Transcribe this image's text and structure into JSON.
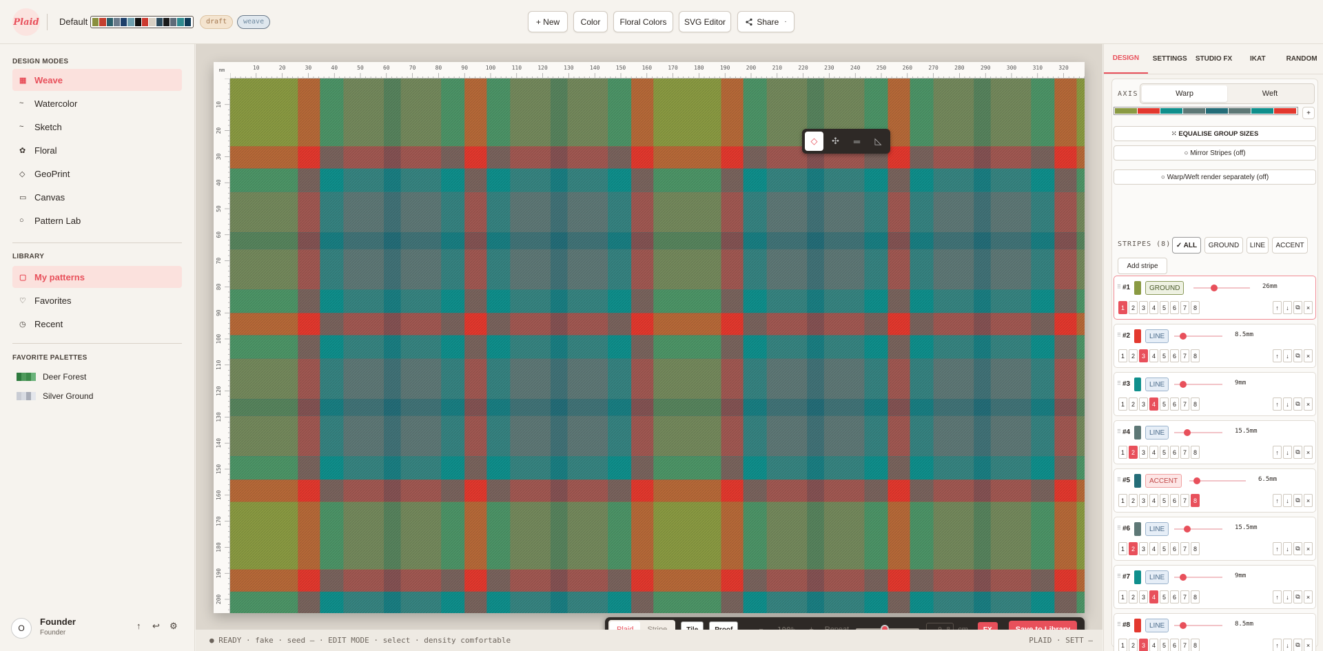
{
  "header": {
    "logo_text": "Plaid",
    "palette_name": "Default",
    "palette_colors": [
      "#8a8f3e",
      "#c4402f",
      "#2b5f6a",
      "#6b7a8a",
      "#1d3f6a",
      "#6f9fae",
      "#111111",
      "#cc3a30",
      "#d8d0c4",
      "#2c4a5c",
      "#1a1a1a",
      "#5e6b78",
      "#2f8a8f",
      "#0e3a56"
    ],
    "badge_draft": "draft",
    "badge_weave": "weave",
    "buttons": {
      "new": "+ New",
      "color": "Color",
      "floral": "Floral Colors",
      "svg": "SVG Editor",
      "share": "Share",
      "share_caret": "·"
    }
  },
  "sidebar": {
    "design_modes_heading": "DESIGN MODES",
    "modes": [
      {
        "icon": "▦",
        "label": "Weave"
      },
      {
        "icon": "~",
        "label": "Watercolor"
      },
      {
        "icon": "~",
        "label": "Sketch"
      },
      {
        "icon": "✿",
        "label": "Floral"
      },
      {
        "icon": "◇",
        "label": "GeoPrint"
      },
      {
        "icon": "▭",
        "label": "Canvas"
      },
      {
        "icon": "○",
        "label": "Pattern Lab"
      }
    ],
    "library_heading": "LIBRARY",
    "library": [
      {
        "icon": "▢",
        "label": "My patterns"
      },
      {
        "icon": "♡",
        "label": "Favorites"
      },
      {
        "icon": "◷",
        "label": "Recent"
      }
    ],
    "favorite_palettes_heading": "FAVORITE PALETTES",
    "favorite_palettes": [
      {
        "label": "Deer Forest",
        "colors": [
          "#2e7a3e",
          "#4f9a5c",
          "#3c8a4a",
          "#6ab37a"
        ]
      },
      {
        "label": "Silver Ground",
        "colors": [
          "#c9ccd4",
          "#d8dbe2",
          "#a9adb8",
          "#e4e6ec"
        ]
      }
    ],
    "user": {
      "initial": "O",
      "name": "Founder",
      "role": "Founder",
      "icons": [
        "↑",
        "↩",
        "⚙"
      ]
    }
  },
  "canvas": {
    "ruler_unit": "mm",
    "ruler_top_ticks": [
      "10",
      "20",
      "30",
      "40",
      "50",
      "60",
      "70",
      "80",
      "90",
      "100",
      "110",
      "120",
      "130",
      "140",
      "150",
      "160",
      "170",
      "180",
      "190",
      "200",
      "210",
      "220",
      "230",
      "240",
      "250",
      "260",
      "270",
      "280",
      "290",
      "300",
      "310",
      "320"
    ],
    "ruler_left_ticks": [
      "10",
      "20",
      "30",
      "40",
      "50",
      "60",
      "70",
      "80",
      "90",
      "100",
      "110",
      "120",
      "130",
      "140",
      "150",
      "160",
      "170",
      "180",
      "190",
      "200"
    ],
    "float_tools": [
      {
        "glyph": "◇",
        "name": "select-tool-icon"
      },
      {
        "glyph": "✣",
        "name": "move-tool-icon"
      },
      {
        "glyph": "═",
        "name": "stripe-tool-icon"
      },
      {
        "glyph": "◺",
        "name": "ruler-tool-icon"
      }
    ]
  },
  "bottombar": {
    "view_plaid": "Plaid",
    "view_stripe": "Stripe",
    "tile": "Tile",
    "proof": "Proof",
    "zoom_minus": "−",
    "zoom": "100%",
    "zoom_plus": "+",
    "repeat_label": "Repeat",
    "repeat_fraction": 0.45,
    "repeat_value": "9,8",
    "repeat_unit": "cm",
    "fx": "FX",
    "save": "Save to Library"
  },
  "status": {
    "left": "● READY · fake · seed — · EDIT MODE · select · density comfortable",
    "right": "PLAID · SETT —"
  },
  "right_panel": {
    "tabs": [
      "DESIGN",
      "SETTINGS",
      "STUDIO FX",
      "IKAT",
      "RANDOM"
    ],
    "axis_label": "AXIS",
    "axis_warp": "Warp",
    "axis_weft": "Weft",
    "add_symbol": "+",
    "equalise": "⁙ EQUALISE GROUP SIZES",
    "mirror": "○ Mirror Stripes (off)",
    "separate": "○ Warp/Weft render separately (off)",
    "stripes_label": "STRIPES (8)",
    "filters": [
      "✓ ALL",
      "GROUND",
      "LINE",
      "ACCENT"
    ],
    "add_stripe": "Add stripe",
    "group_numbers": [
      "1",
      "2",
      "3",
      "4",
      "5",
      "6",
      "7",
      "8"
    ],
    "action_icons": [
      "↑",
      "↓",
      "⧉",
      "×"
    ],
    "stripes": [
      {
        "num": "#1",
        "color": "#8a9a42",
        "tag": "GROUND",
        "width": "26mm",
        "group": 1,
        "level": 0.28
      },
      {
        "num": "#2",
        "color": "#e3382e",
        "tag": "LINE",
        "width": "8.5mm",
        "group": 3,
        "level": 0.1
      },
      {
        "num": "#3",
        "color": "#0f8f8c",
        "tag": "LINE",
        "width": "9mm",
        "group": 4,
        "level": 0.1
      },
      {
        "num": "#4",
        "color": "#5e7876",
        "tag": "LINE",
        "width": "15.5mm",
        "group": 2,
        "level": 0.18
      },
      {
        "num": "#5",
        "color": "#246d78",
        "tag": "ACCENT",
        "width": "6.5mm",
        "group": 8,
        "level": 0.07
      },
      {
        "num": "#6",
        "color": "#5e7876",
        "tag": "LINE",
        "width": "15.5mm",
        "group": 2,
        "level": 0.18
      },
      {
        "num": "#7",
        "color": "#0f8f8c",
        "tag": "LINE",
        "width": "9mm",
        "group": 4,
        "level": 0.1
      },
      {
        "num": "#8",
        "color": "#e3382e",
        "tag": "LINE",
        "width": "8.5mm",
        "group": 3,
        "level": 0.1
      }
    ],
    "strip_colors": [
      "#8a9a42",
      "#e3382e",
      "#0f8f8c",
      "#5e7876",
      "#246d78",
      "#5e7876",
      "#0f8f8c",
      "#e3382e"
    ]
  }
}
